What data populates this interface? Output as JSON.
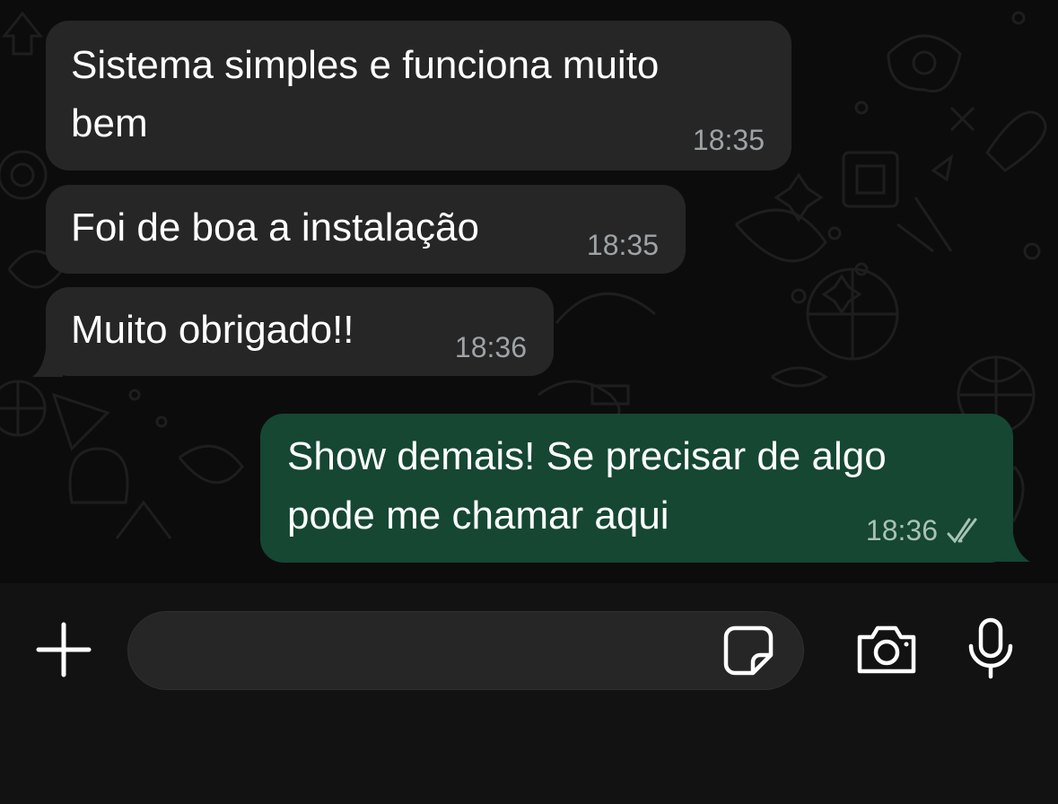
{
  "messages": [
    {
      "direction": "incoming",
      "text_line1": "Sistema simples e funciona muito",
      "text_line2": "bem",
      "time": "18:35"
    },
    {
      "direction": "incoming",
      "text": "Foi de boa a instalação",
      "time": "18:35"
    },
    {
      "direction": "incoming",
      "text": "Muito obrigado!!",
      "time": "18:36"
    },
    {
      "direction": "outgoing",
      "text_line1": "Show demais! Se precisar de algo",
      "text_line2": "pode me chamar aqui",
      "time": "18:36",
      "status_icon": "double-check-icon"
    }
  ],
  "input_bar": {
    "message_value": "",
    "icons": [
      "plus-icon",
      "sticker-icon",
      "camera-icon",
      "microphone-icon"
    ]
  },
  "colors": {
    "incoming_bubble": "#262626",
    "outgoing_bubble": "#154733",
    "background": "#0c0c0c",
    "input_bar": "#121212"
  }
}
